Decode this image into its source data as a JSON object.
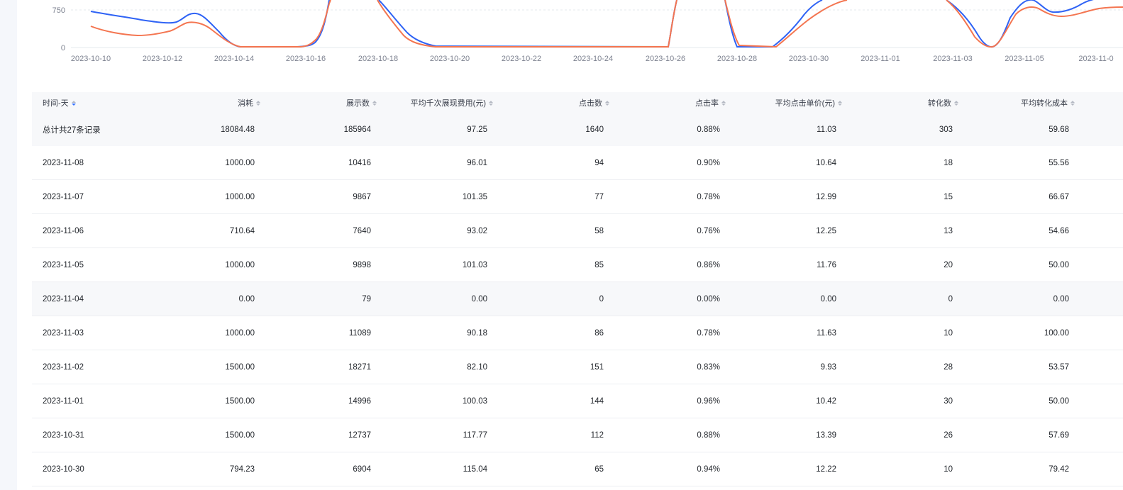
{
  "chart": {
    "y_ticks": [
      "750",
      "0"
    ],
    "x_ticks": [
      "2023-10-10",
      "2023-10-12",
      "2023-10-14",
      "2023-10-16",
      "2023-10-18",
      "2023-10-20",
      "2023-10-22",
      "2023-10-24",
      "2023-10-26",
      "2023-10-28",
      "2023-10-30",
      "2023-11-01",
      "2023-11-03",
      "2023-11-05",
      "2023-11-0"
    ],
    "colors": {
      "series_a": "#2f63f5",
      "series_b": "#f47550",
      "grid": "#e6e8ee"
    }
  },
  "table": {
    "columns": [
      {
        "label": "时间-天",
        "sort_active": true
      },
      {
        "label": "消耗"
      },
      {
        "label": "展示数"
      },
      {
        "label": "平均千次展现费用(元)"
      },
      {
        "label": "点击数"
      },
      {
        "label": "点击率"
      },
      {
        "label": "平均点击单价(元)"
      },
      {
        "label": "转化数"
      },
      {
        "label": "平均转化成本"
      }
    ],
    "summary": [
      "总计共27条记录",
      "18084.48",
      "185964",
      "97.25",
      "1640",
      "0.88%",
      "11.03",
      "303",
      "59.68"
    ],
    "rows": [
      [
        "2023-11-08",
        "1000.00",
        "10416",
        "96.01",
        "94",
        "0.90%",
        "10.64",
        "18",
        "55.56"
      ],
      [
        "2023-11-07",
        "1000.00",
        "9867",
        "101.35",
        "77",
        "0.78%",
        "12.99",
        "15",
        "66.67"
      ],
      [
        "2023-11-06",
        "710.64",
        "7640",
        "93.02",
        "58",
        "0.76%",
        "12.25",
        "13",
        "54.66"
      ],
      [
        "2023-11-05",
        "1000.00",
        "9898",
        "101.03",
        "85",
        "0.86%",
        "11.76",
        "20",
        "50.00"
      ],
      [
        "2023-11-04",
        "0.00",
        "79",
        "0.00",
        "0",
        "0.00%",
        "0.00",
        "0",
        "0.00"
      ],
      [
        "2023-11-03",
        "1000.00",
        "11089",
        "90.18",
        "86",
        "0.78%",
        "11.63",
        "10",
        "100.00"
      ],
      [
        "2023-11-02",
        "1500.00",
        "18271",
        "82.10",
        "151",
        "0.83%",
        "9.93",
        "28",
        "53.57"
      ],
      [
        "2023-11-01",
        "1500.00",
        "14996",
        "100.03",
        "144",
        "0.96%",
        "10.42",
        "30",
        "50.00"
      ],
      [
        "2023-10-31",
        "1500.00",
        "12737",
        "117.77",
        "112",
        "0.88%",
        "13.39",
        "26",
        "57.69"
      ],
      [
        "2023-10-30",
        "794.23",
        "6904",
        "115.04",
        "65",
        "0.94%",
        "12.22",
        "10",
        "79.42"
      ]
    ]
  }
}
